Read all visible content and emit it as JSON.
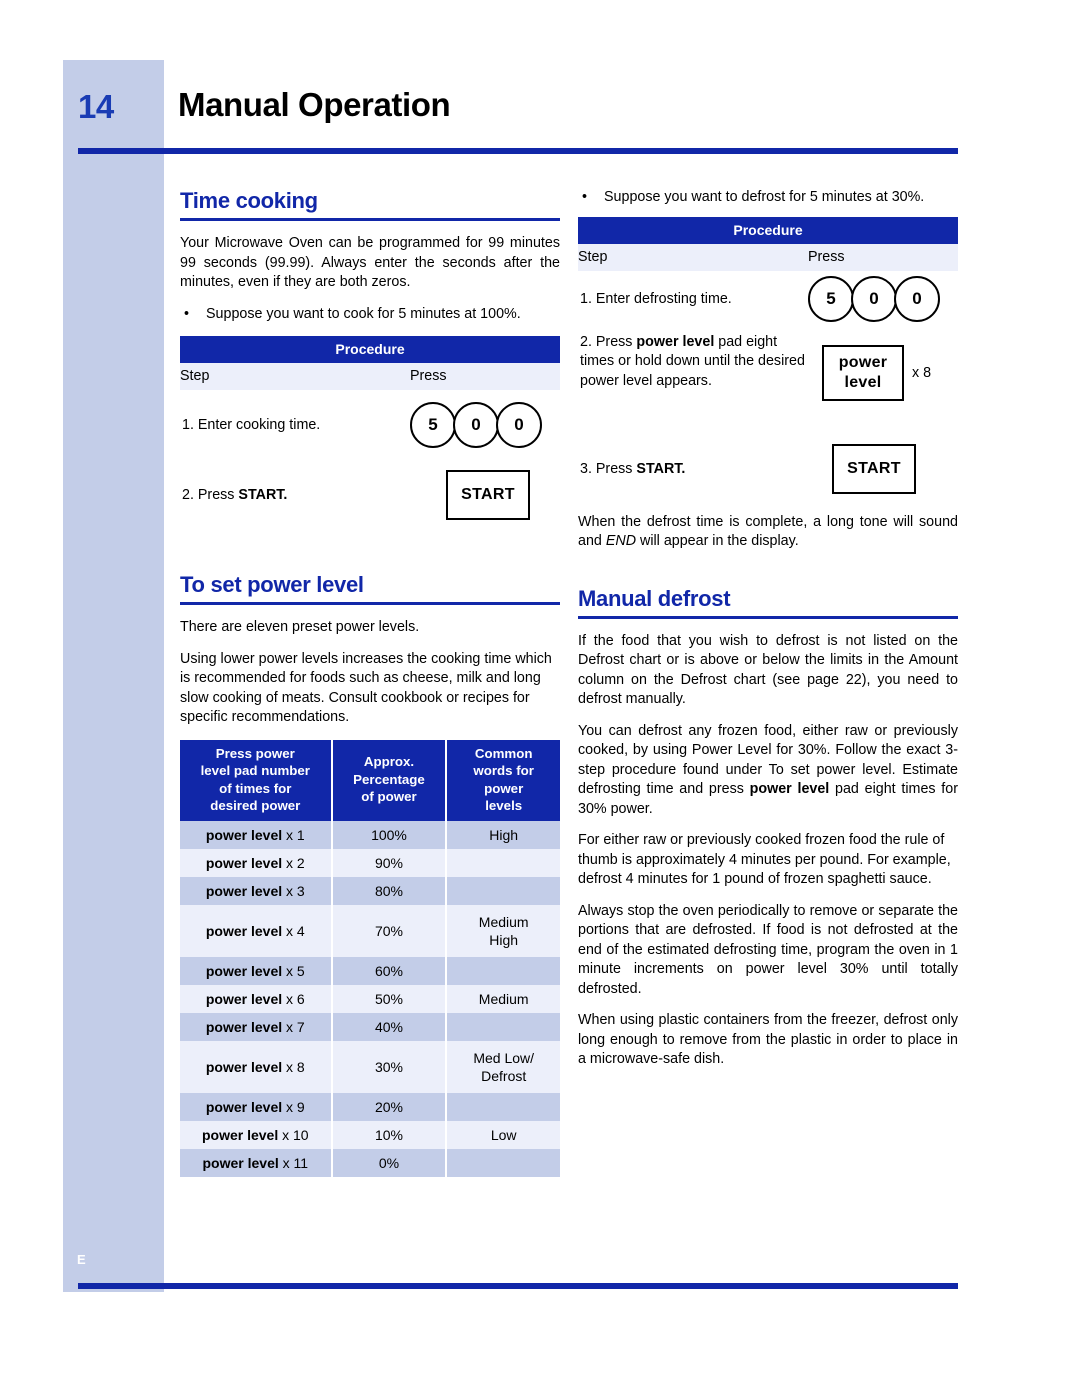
{
  "header": {
    "page_number": "14",
    "title": "Manual Operation",
    "side_letter": "E"
  },
  "left": {
    "time_cooking": {
      "heading": "Time cooking",
      "p1": "Your Microwave Oven can be programmed for 99 minutes 99 seconds (99.99). Always enter the seconds after the minutes, even if they are both zeros.",
      "bullet": "Suppose you want to cook for 5 minutes at 100%.",
      "bullet_dot": "•",
      "procedure": {
        "title": "Procedure",
        "col_step": "Step",
        "col_press": "Press",
        "rows": [
          {
            "step": "1. Enter cooking time.",
            "keys": [
              "5",
              "0",
              "0"
            ],
            "key_type": "circles"
          },
          {
            "step_pre": "2. Press ",
            "step_bold": "START.",
            "key_label": "START",
            "key_type": "box"
          }
        ]
      }
    },
    "power_level": {
      "heading": "To set power level",
      "p1": "There are eleven preset power levels.",
      "p2": "Using lower power levels increases the cooking time which is recommended for foods such as cheese, milk and long slow cooking of meats. Consult cookbook or recipes for specific recommendations.",
      "table": {
        "headers": [
          "Press power level pad number of times for desired power",
          "Approx. Percentage of power",
          "Common words for power levels"
        ],
        "header_lines": [
          [
            "Press power",
            "level pad number",
            "of times for",
            "desired power"
          ],
          [
            "Approx.",
            "Percentage",
            "of power"
          ],
          [
            "Common",
            "words for",
            "power",
            "levels"
          ]
        ],
        "rows": [
          {
            "pad": "power level",
            "times": "x 1",
            "percent": "100%",
            "word": "High"
          },
          {
            "pad": "power level",
            "times": "x 2",
            "percent": "90%",
            "word": ""
          },
          {
            "pad": "power level",
            "times": "x 3",
            "percent": "80%",
            "word": ""
          },
          {
            "pad": "power level",
            "times": "x 4",
            "percent": "70%",
            "word": "Medium High"
          },
          {
            "pad": "power level",
            "times": "x 5",
            "percent": "60%",
            "word": ""
          },
          {
            "pad": "power level",
            "times": "x 6",
            "percent": "50%",
            "word": "Medium"
          },
          {
            "pad": "power level",
            "times": "x 7",
            "percent": "40%",
            "word": ""
          },
          {
            "pad": "power level",
            "times": "x 8",
            "percent": "30%",
            "word": "Med Low/ Defrost"
          },
          {
            "pad": "power level",
            "times": "x 9",
            "percent": "20%",
            "word": ""
          },
          {
            "pad": "power level",
            "times": "x 10",
            "percent": "10%",
            "word": "Low"
          },
          {
            "pad": "power level",
            "times": "x 11",
            "percent": "0%",
            "word": ""
          }
        ]
      }
    }
  },
  "right": {
    "defrost_example": {
      "bullet_dot": "•",
      "bullet": "Suppose you want to defrost for 5 minutes at 30%.",
      "procedure": {
        "title": "Procedure",
        "col_step": "Step",
        "col_press": "Press",
        "row1_step": "1. Enter defrosting time.",
        "row1_keys": [
          "5",
          "0",
          "0"
        ],
        "row2_pre": "2. Press ",
        "row2_bold": "power level",
        "row2_post": " pad eight times or hold down until the desired power level appears.",
        "row2_key_line1": "power",
        "row2_key_line2": "level",
        "row2_key_note": "x 8",
        "row3_pre": "3. Press ",
        "row3_bold": "START.",
        "row3_key": "START"
      },
      "closing_pre": "When the defrost time is complete, a long tone will sound and ",
      "closing_italic": "END",
      "closing_post": " will appear in the display."
    },
    "manual_defrost": {
      "heading": "Manual defrost",
      "p1": "If the food that you wish to defrost is not listed on the Defrost chart or is above or below the limits in the Amount column on the Defrost chart (see page 22), you need to defrost manually.",
      "p2_pre": "You can defrost any frozen food, either raw or previously cooked, by using Power Level for 30%. Follow the exact 3-step procedure found under To set power level. Estimate defrosting time and press ",
      "p2_bold": "power level",
      "p2_post": " pad eight times for 30% power.",
      "p3": "For either raw or previously cooked frozen food the rule of thumb is approximately 4 minutes per pound. For example, defrost 4 minutes for 1 pound of frozen spaghetti sauce.",
      "p4": "Always stop the oven periodically to remove or separate the portions that are defrosted. If food is not defrosted at the end of the estimated defrosting time, program the oven in 1 minute increments on power level 30% until totally defrosted.",
      "p5": "When using plastic containers from the freezer, defrost only long enough to remove from the plastic in order to place in a microwave-safe dish."
    }
  },
  "colors": {
    "brand_blue": "#1127a8",
    "tab_blue": "#c3cde8",
    "row_light": "#eceffa"
  }
}
